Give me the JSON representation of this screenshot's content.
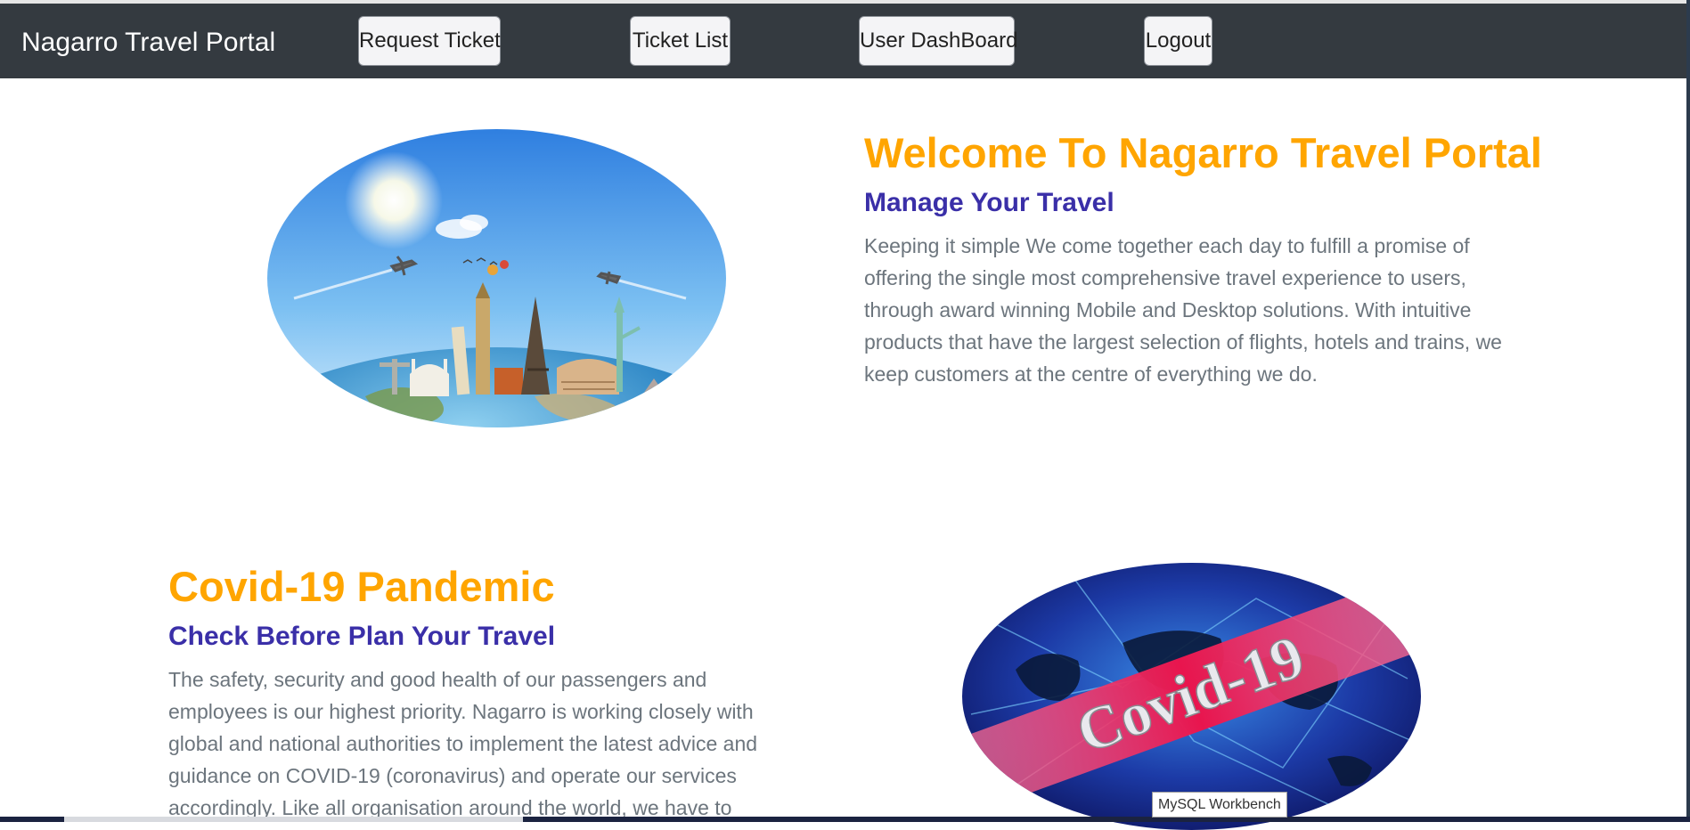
{
  "navbar": {
    "brand": "Nagarro Travel Portal",
    "buttons": {
      "request_ticket": "Request Ticket",
      "ticket_list": "Ticket List",
      "user_dashboard": "User DashBoard",
      "logout": "Logout"
    }
  },
  "welcome": {
    "title": "Welcome To Nagarro Travel Portal",
    "subtitle": "Manage Your Travel",
    "body": "Keeping it simple We come together each day to fulfill a promise of offering the single most comprehensive travel experience to users, through award winning Mobile and Desktop solutions. With intuitive products that have the largest selection of flights, hotels and trains, we keep customers at the centre of everything we do."
  },
  "covid": {
    "title": "Covid-19 Pandemic",
    "subtitle": "Check Before Plan Your Travel",
    "body": "The safety, security and good health of our passengers and employees is our highest priority. Nagarro is working closely with global and national authorities to implement the latest advice and guidance on COVID-19 (coronavirus) and operate our services accordingly. Like all organisation around the world, we have to",
    "image_text": "Covid-19"
  },
  "taskbar": {
    "tooltip": "MySQL Workbench"
  },
  "colors": {
    "navbar_bg": "#343a40",
    "title": "#ffa500",
    "subtitle": "#3a2fa8",
    "body_text": "#6c757d"
  }
}
